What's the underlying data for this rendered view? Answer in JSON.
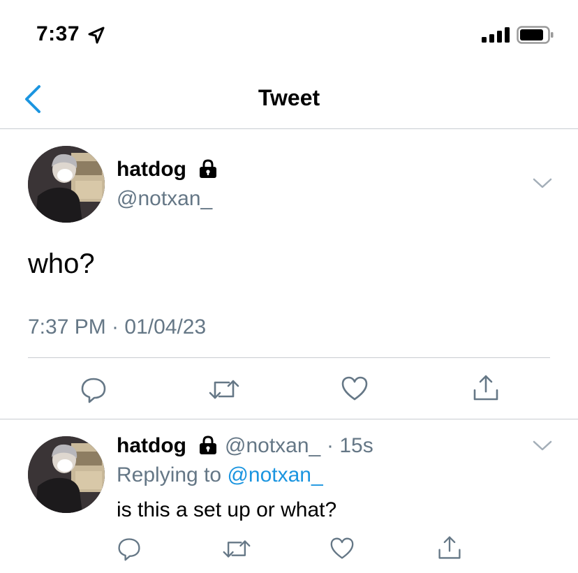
{
  "status_bar": {
    "time": "7:37"
  },
  "nav": {
    "title": "Tweet"
  },
  "main_tweet": {
    "display_name": "hatdog",
    "handle": "@notxan_",
    "text": "who?",
    "timestamp": "7:37 PM · 01/04/23"
  },
  "reply_tweet": {
    "display_name": "hatdog",
    "handle": "@notxan_",
    "age": "· 15s",
    "replying_prefix": "Replying to",
    "replying_to": "@notxan_",
    "text": "is this a set up or what?"
  },
  "colors": {
    "accent": "#1b95e0",
    "secondary_text": "#657786",
    "divider": "#c8ccd1"
  },
  "icons": [
    "location-arrow-icon",
    "signal-icon",
    "battery-icon",
    "back-chevron-icon",
    "lock-icon",
    "chevron-down-icon",
    "reply-icon",
    "retweet-icon",
    "like-icon",
    "share-icon"
  ]
}
